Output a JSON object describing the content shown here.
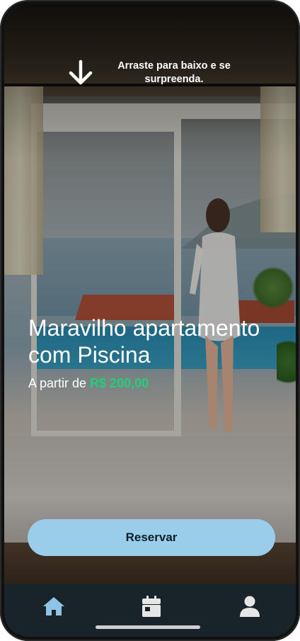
{
  "hint": {
    "text": "Arraste para baixo e se surpreenda.",
    "icon": "arrow-down-icon"
  },
  "listing": {
    "title": "Maravilho apartamento com Piscina",
    "price_prefix": "A partir de ",
    "price": "R$ 200,00"
  },
  "actions": {
    "reserve_label": "Reservar"
  },
  "tabbar": {
    "items": [
      {
        "name": "home",
        "icon": "home-icon",
        "active": true
      },
      {
        "name": "calendar",
        "icon": "calendar-icon",
        "active": false
      },
      {
        "name": "profile",
        "icon": "user-icon",
        "active": false
      }
    ]
  },
  "colors": {
    "accent_price": "#21d07a",
    "button_bg": "#9acdea",
    "tabbar_bg": "#19232a",
    "active_tab": "#8fc4e6",
    "inactive_tab": "#e6e6e6"
  }
}
